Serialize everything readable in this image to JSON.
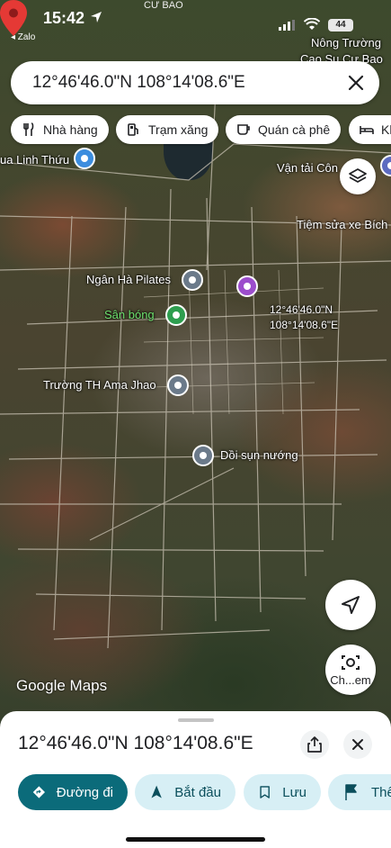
{
  "status_bar": {
    "time": "15:42",
    "back_app": "◂ Zalo",
    "battery": "44",
    "carrier_label": "CƯ BAO"
  },
  "search": {
    "query": "12°46'46.0\"N 108°14'08.6\"E"
  },
  "chips": [
    {
      "label": "Nhà hàng",
      "icon": "restaurant-icon"
    },
    {
      "label": "Trạm xăng",
      "icon": "gas-station-icon"
    },
    {
      "label": "Quán cà phê",
      "icon": "coffee-icon"
    },
    {
      "label": "Kh",
      "icon": "hotel-icon"
    }
  ],
  "map": {
    "labels": {
      "nong_truong": "Nông Trường",
      "cao_su": "Cao Su Cư Bao",
      "linh_thuu": "ua Linh Thứu",
      "van_tai": "Vận tải Côn",
      "tiem_sua": "Tiệm sửa xe Bích",
      "ngan_ha": "Ngân Hà Pilates",
      "san_bong": "Sân bóng",
      "truong_th": "Trường TH Ama Jhao",
      "doi_sun": "Dồi sụn nướng"
    },
    "pin_label_line1": "12°46'46.0\"N",
    "pin_label_line2": "108°14'08.6\"E",
    "attribution": "Google Maps",
    "lens_label": "Ch...em",
    "accent_pin_color": "#e53935"
  },
  "sheet": {
    "title": "12°46'46.0\"N 108°14'08.6\"E",
    "actions": {
      "directions": "Đường đi",
      "start": "Bắt đầu",
      "save": "Lưu",
      "more": "Thê"
    }
  }
}
